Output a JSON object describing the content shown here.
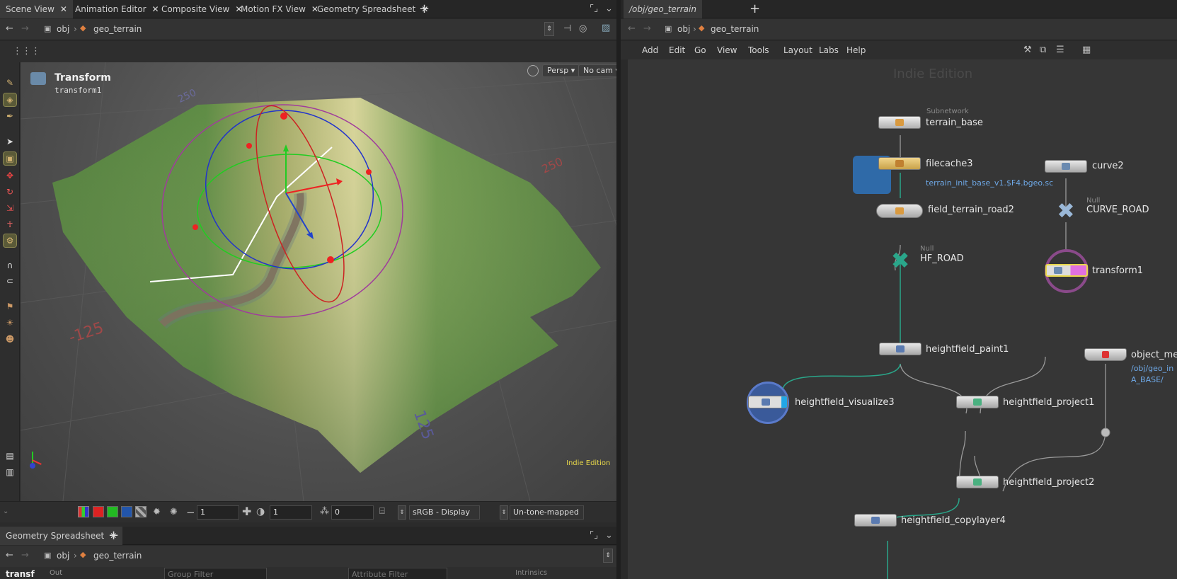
{
  "left_tabs": [
    {
      "label": "Scene View",
      "active": true
    },
    {
      "label": "Animation Editor",
      "active": false
    },
    {
      "label": "Composite View",
      "active": false
    },
    {
      "label": "Motion FX View",
      "active": false
    },
    {
      "label": "Geometry Spreadsheet",
      "active": false
    }
  ],
  "right_tabs": [
    {
      "label": "/obj/geo_terrain",
      "active": true
    }
  ],
  "path": {
    "obj": "obj",
    "geo": "geo_terrain"
  },
  "viewport": {
    "tool_title": "Transform",
    "tool_sub": "transform1",
    "persp": "Persp",
    "cam": "No cam",
    "edition": "Indie Edition",
    "grid_labels": [
      "250",
      "250",
      "-125",
      "125"
    ]
  },
  "viewport_bottom": {
    "field1": "1",
    "field2": "1",
    "field3": "0",
    "color_space": "sRGB - Display",
    "tonemap": "Un-tone-mapped"
  },
  "bottom_pane": {
    "tab": "Geometry Spreadsheet",
    "node_label": "transf",
    "group_filter": "Group Filter",
    "attribute_filter": "Attribute Filter",
    "intrinsics": "Intrinsics",
    "out_label": "Out"
  },
  "network_menu": [
    "Add",
    "Edit",
    "Go",
    "View",
    "Tools",
    "Layout",
    "Labs",
    "Help"
  ],
  "network": {
    "edition": "Indie Edition",
    "nodes": {
      "terrain_base": {
        "type": "Subnetwork",
        "label": "terrain_base"
      },
      "filecache3": {
        "label": "filecache3",
        "sub": "terrain_init_base_v1.$F4.bgeo.sc"
      },
      "curve2": {
        "label": "curve2"
      },
      "field_terrain_road2": {
        "label": "field_terrain_road2"
      },
      "CURVE_ROAD": {
        "type": "Null",
        "label": "CURVE_ROAD"
      },
      "HF_ROAD": {
        "type": "Null",
        "label": "HF_ROAD"
      },
      "transform1": {
        "label": "transform1"
      },
      "heightfield_paint1": {
        "label": "heightfield_paint1"
      },
      "object_merge": {
        "label": "object_me",
        "sub1": "/obj/geo_in",
        "sub2": "A_BASE/"
      },
      "heightfield_visualize3": {
        "label": "heightfield_visualize3"
      },
      "heightfield_project1": {
        "label": "heightfield_project1"
      },
      "heightfield_project2": {
        "label": "heightfield_project2"
      },
      "heightfield_copylayer4": {
        "label": "heightfield_copylayer4"
      }
    }
  },
  "colors": {
    "accent": "#e8d84a",
    "wire": "#2aa68a",
    "link": "#6ea8e6"
  },
  "icons": [
    "back-arrow-icon",
    "forward-arrow-icon",
    "close-icon",
    "plus-icon",
    "maximize-icon",
    "chevron-down-icon",
    "grid-icon",
    "help-icon",
    "hammer-icon",
    "list-icon",
    "lock-icon"
  ]
}
